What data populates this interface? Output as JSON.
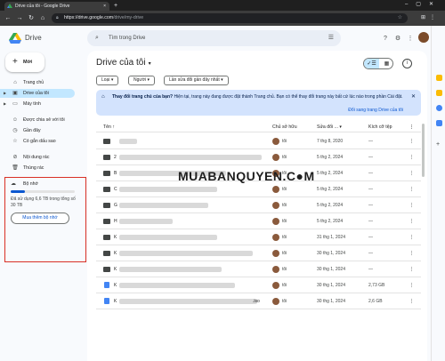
{
  "browser": {
    "tab_title": "Drive của tôi - Google Drive",
    "url_host": "https://drive.google.com",
    "url_path": "/drive/my-drive"
  },
  "header": {
    "brand": "Drive",
    "search_placeholder": "Tìm trong Drive"
  },
  "sidebar": {
    "new_label": "Mới",
    "items": [
      {
        "label": "Trang chủ",
        "icon": "home-icon"
      },
      {
        "label": "Drive của tôi",
        "icon": "drive-icon"
      },
      {
        "label": "Máy tính",
        "icon": "computer-icon"
      },
      {
        "label": "Được chia sẻ với tôi",
        "icon": "shared-icon"
      },
      {
        "label": "Gần đây",
        "icon": "clock-icon"
      },
      {
        "label": "Có gắn dấu sao",
        "icon": "star-icon"
      },
      {
        "label": "Nội dung rác",
        "icon": "spam-icon"
      },
      {
        "label": "Thùng rác",
        "icon": "trash-icon"
      }
    ],
    "storage": {
      "title": "Bộ nhớ",
      "used_text": "Đã sử dụng 6,6 TB trong tổng số 30 TB",
      "used_fraction": 0.22,
      "button": "Mua thêm bộ nhớ"
    }
  },
  "main": {
    "title": "Drive của tôi",
    "filters": [
      "Loại",
      "Người",
      "Lần sửa đổi gần đây nhất"
    ],
    "banner": {
      "heading": "Thay đổi trang chủ của bạn?",
      "body": "Hiện tại, trang này đang được đặt thành Trang chủ. Bạn có thể thay đổi trang này bất cứ lúc nào trong phần Cài đặt.",
      "action": "Đổi sang trang Drive của tôi"
    },
    "columns": {
      "name": "Tên",
      "owner": "Chủ sở hữu",
      "modified": "Sửa đổi ...",
      "size": "Kích cỡ tệp"
    },
    "rows": [
      {
        "name": "",
        "type": "folder",
        "owner": "tôi",
        "modified": "7 thg 8, 2020",
        "size": "—"
      },
      {
        "name": "2",
        "type": "folder",
        "owner": "tôi",
        "modified": "5 thg 2, 2024",
        "size": "—"
      },
      {
        "name": "B",
        "type": "folder",
        "owner": "tôi",
        "modified": "5 thg 2, 2024",
        "size": "—"
      },
      {
        "name": "C",
        "type": "folder",
        "owner": "tôi",
        "modified": "5 thg 2, 2024",
        "size": "—"
      },
      {
        "name": "G",
        "type": "folder",
        "owner": "tôi",
        "modified": "5 thg 2, 2024",
        "size": "—"
      },
      {
        "name": "H",
        "type": "folder",
        "owner": "tôi",
        "modified": "5 thg 2, 2024",
        "size": "—"
      },
      {
        "name": "K",
        "type": "folder",
        "owner": "tôi",
        "modified": "31 thg 1, 2024",
        "size": "—"
      },
      {
        "name": "K",
        "type": "folder",
        "owner": "tôi",
        "modified": "30 thg 1, 2024",
        "size": "—"
      },
      {
        "name": "K",
        "type": "folder",
        "owner": "tôi",
        "modified": "30 thg 1, 2024",
        "size": "—"
      },
      {
        "name": "K",
        "type": "file",
        "owner": "tôi",
        "modified": "30 thg 1, 2024",
        "size": "2,73 GB"
      },
      {
        "name": "K",
        "type": "file",
        "owner": "tôi",
        "modified": "30 thg 1, 2024",
        "size": "2,6 GB"
      }
    ],
    "last_row_suffix": ".iso"
  },
  "watermark": "MUABANQUYEN.C●M"
}
